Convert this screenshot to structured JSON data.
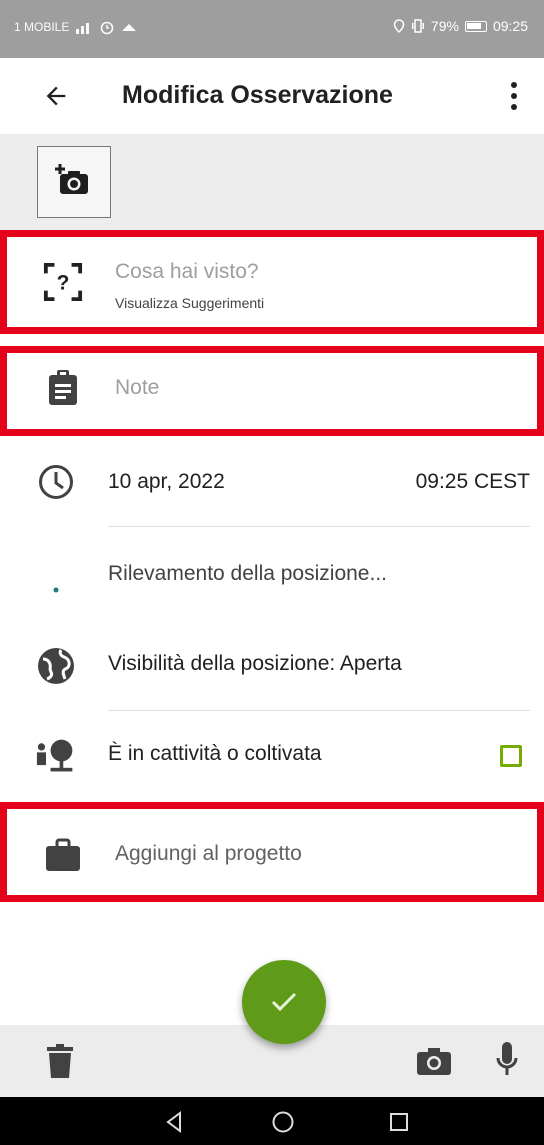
{
  "status_bar": {
    "carrier": "1 MOBILE",
    "battery": "79%",
    "time": "09:25"
  },
  "app_bar": {
    "title": "Modifica Osservazione",
    "back_icon": "arrow-left-icon",
    "menu_icon": "more-vert-icon"
  },
  "photos": {
    "add_photo_icon": "add-camera-icon"
  },
  "species": {
    "placeholder": "Cosa hai visto?",
    "suggestions_label": "Visualizza Suggerimenti",
    "icon": "species-unknown-icon"
  },
  "notes": {
    "placeholder": "Note",
    "icon": "clipboard-icon"
  },
  "datetime": {
    "date": "10 apr, 2022",
    "time": "09:25 CEST",
    "icon": "clock-icon"
  },
  "location": {
    "status": "Rilevamento della posizione...",
    "icon": "location-dot-icon"
  },
  "geoprivacy": {
    "label": "Visibilità della posizione: Aperta",
    "icon": "globe-icon"
  },
  "captive": {
    "label": "È in cattività o coltivata",
    "checked": false,
    "icon": "captive-plant-icon"
  },
  "project": {
    "label": "Aggiungi al progetto",
    "icon": "briefcase-icon"
  },
  "bottom_bar": {
    "delete_icon": "trash-icon",
    "camera_icon": "camera-icon",
    "mic_icon": "microphone-icon",
    "fab_icon": "check-icon"
  },
  "nav": {
    "back_icon": "nav-back-icon",
    "home_icon": "nav-home-icon",
    "recents_icon": "nav-recents-icon"
  },
  "colors": {
    "accent": "#74ac00",
    "fab": "#5f9a19",
    "highlight": "#e5001b",
    "icon": "#424242"
  }
}
